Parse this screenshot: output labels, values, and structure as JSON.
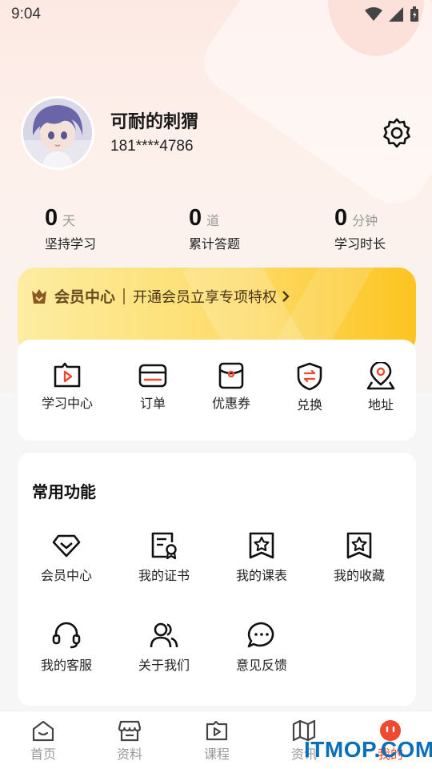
{
  "status_bar": {
    "time": "9:04"
  },
  "profile": {
    "name": "可耐的刺猬",
    "phone": "181****4786"
  },
  "stats": [
    {
      "value": "0",
      "unit": "天",
      "label": "坚持学习"
    },
    {
      "value": "0",
      "unit": "道",
      "label": "累计答题"
    },
    {
      "value": "0",
      "unit": "分钟",
      "label": "学习时长"
    }
  ],
  "vip": {
    "title": "会员中心",
    "subtitle": "开通会员立享专项特权"
  },
  "quick_actions": [
    {
      "label": "学习中心",
      "icon": "play-square-icon"
    },
    {
      "label": "订单",
      "icon": "card-icon"
    },
    {
      "label": "优惠券",
      "icon": "coupon-icon"
    },
    {
      "label": "兑换",
      "icon": "exchange-shield-icon"
    },
    {
      "label": "地址",
      "icon": "location-icon"
    }
  ],
  "common": {
    "title": "常用功能",
    "items": [
      {
        "label": "会员中心",
        "icon": "diamond-icon"
      },
      {
        "label": "我的证书",
        "icon": "certificate-icon"
      },
      {
        "label": "我的课表",
        "icon": "star-bookmark-icon"
      },
      {
        "label": "我的收藏",
        "icon": "star-bookmark-icon"
      },
      {
        "label": "我的客服",
        "icon": "headset-icon"
      },
      {
        "label": "关于我们",
        "icon": "users-icon"
      },
      {
        "label": "意见反馈",
        "icon": "chat-bubble-icon"
      }
    ]
  },
  "tabbar": [
    {
      "label": "首页",
      "icon": "home-icon"
    },
    {
      "label": "资料",
      "icon": "store-icon"
    },
    {
      "label": "课程",
      "icon": "video-icon"
    },
    {
      "label": "资讯",
      "icon": "map-icon"
    },
    {
      "label": "我的",
      "icon": "face-icon",
      "active": true
    }
  ],
  "watermark": "ITMOP.COM",
  "colors": {
    "accent": "#f0492f",
    "vip_gold": "#fcc41f",
    "vip_text": "#6b4a1f"
  }
}
